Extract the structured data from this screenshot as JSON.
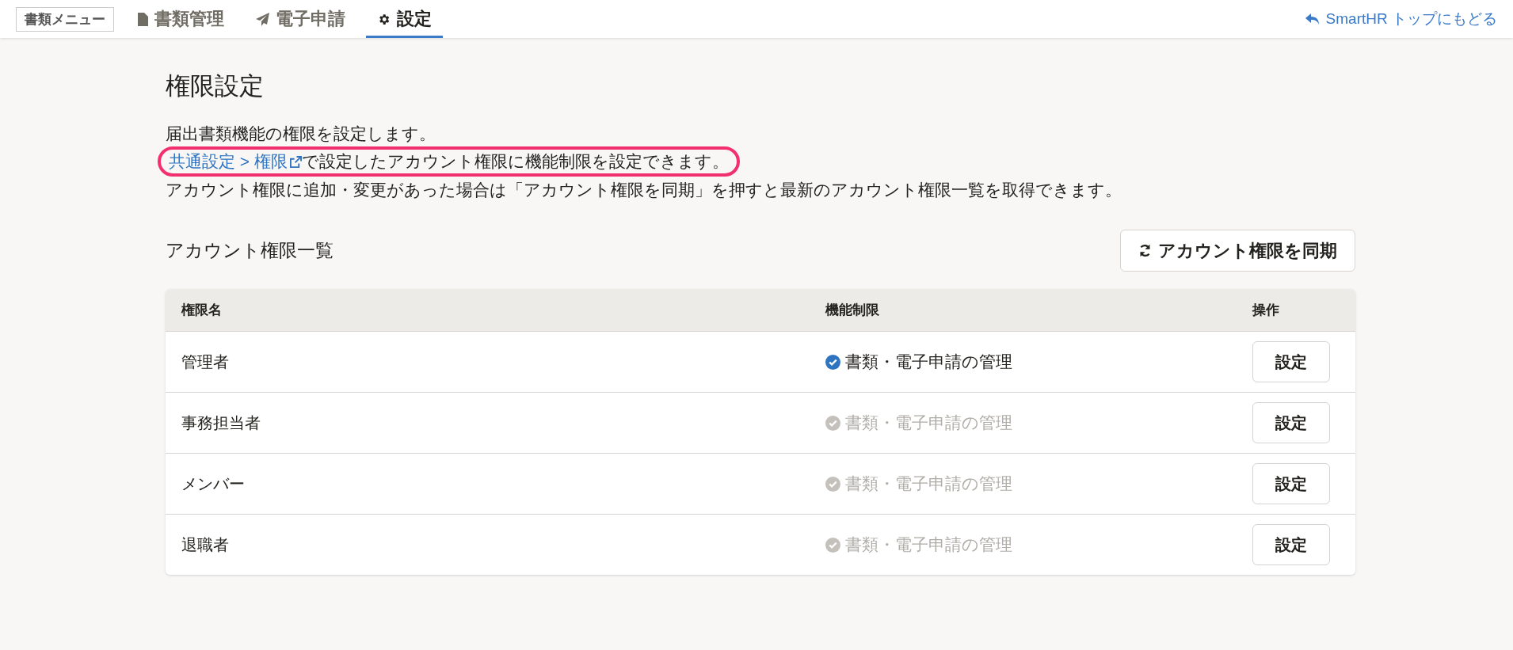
{
  "header": {
    "menu_label": "書類メニュー",
    "tabs": [
      {
        "label": "書類管理",
        "kind": "document",
        "selected": false
      },
      {
        "label": "電子申請",
        "kind": "send",
        "selected": false
      },
      {
        "label": "設定",
        "kind": "gear",
        "selected": true
      }
    ],
    "back_link": "SmartHR トップにもどる"
  },
  "page": {
    "title": "権限設定",
    "description": [
      {
        "kind": "text",
        "text": "届出書類機能の権限を設定します。"
      },
      {
        "kind": "link",
        "link": "共通設定 > 権限",
        "text": "で設定したアカウント権限に機能制限を設定できます。",
        "highlighted": true
      },
      {
        "kind": "text",
        "text": "アカウント権限に追加・変更があった場合は「アカウント権限を同期」を押すと最新のアカウント権限一覧を取得できます。"
      }
    ]
  },
  "section": {
    "title": "アカウント権限一覧",
    "sync_button": "アカウント権限を同期"
  },
  "table": {
    "columns": [
      "権限名",
      "機能制限",
      "操作"
    ],
    "rows": [
      {
        "name": "管理者",
        "feature": "書類・電子申請の管理",
        "checked": true,
        "action": "設定"
      },
      {
        "name": "事務担当者",
        "feature": "書類・電子申請の管理",
        "checked": false,
        "action": "設定"
      },
      {
        "name": "メンバー",
        "feature": "書類・電子申請の管理",
        "checked": false,
        "action": "設定"
      },
      {
        "name": "退職者",
        "feature": "書類・電子申請の管理",
        "checked": false,
        "action": "設定"
      }
    ]
  }
}
